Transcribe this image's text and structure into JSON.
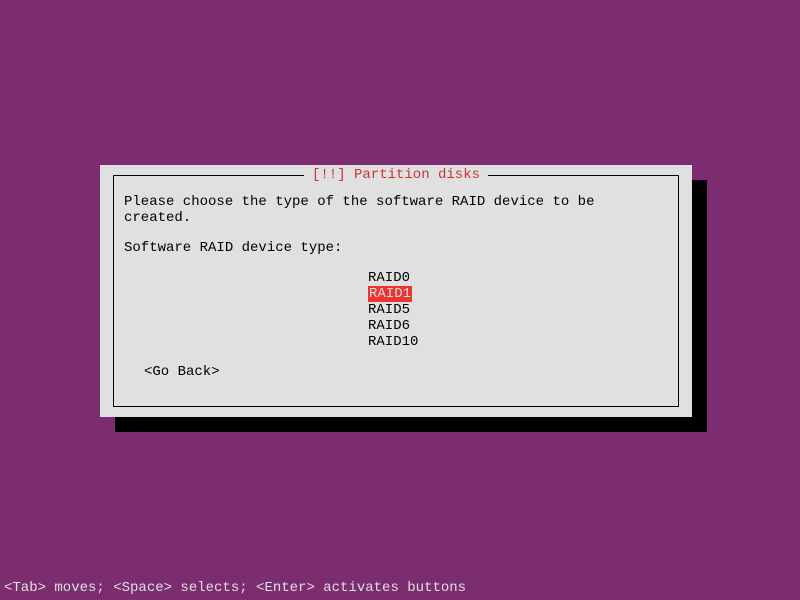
{
  "dialog": {
    "title": "[!!] Partition disks",
    "instruction": "Please choose the type of the software RAID device to be created.",
    "label": "Software RAID device type:",
    "options": [
      {
        "text": "RAID0",
        "selected": false
      },
      {
        "text": "RAID1",
        "selected": true
      },
      {
        "text": "RAID5",
        "selected": false
      },
      {
        "text": "RAID6",
        "selected": false
      },
      {
        "text": "RAID10",
        "selected": false
      }
    ],
    "go_back": "<Go Back>"
  },
  "help_bar": "<Tab> moves; <Space> selects; <Enter> activates buttons"
}
